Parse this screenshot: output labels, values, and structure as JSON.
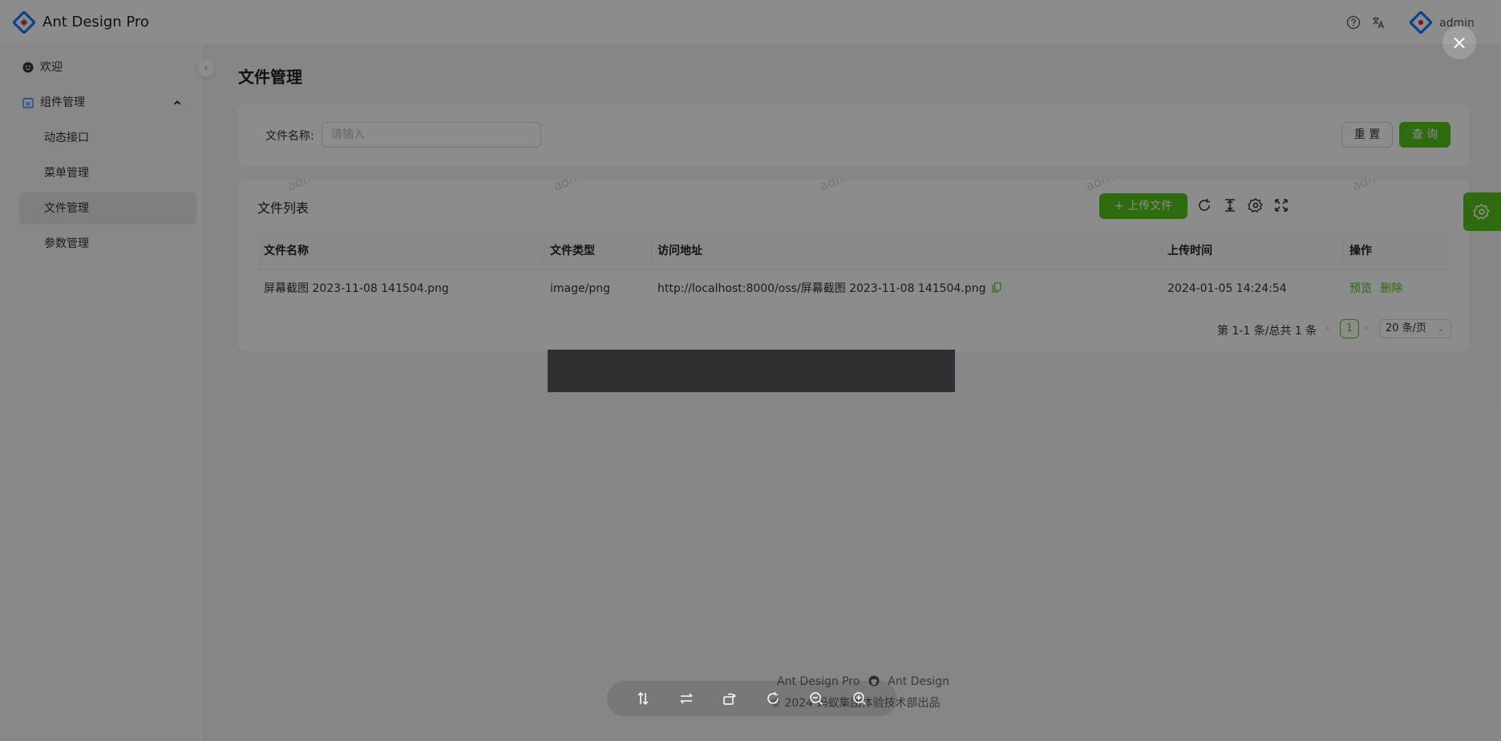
{
  "app": {
    "title": "Ant Design Pro"
  },
  "header": {
    "user_name": "admin",
    "icons": [
      "question-icon",
      "translate-icon"
    ]
  },
  "sidebar": {
    "items": [
      {
        "label": "欢迎",
        "icon": "smile-icon"
      },
      {
        "label": "组件管理",
        "icon": "component-icon",
        "expanded": true
      }
    ],
    "subitems": [
      {
        "label": "动态接口"
      },
      {
        "label": "菜单管理"
      },
      {
        "label": "文件管理",
        "active": true
      },
      {
        "label": "参数管理"
      }
    ]
  },
  "page": {
    "title": "文件管理"
  },
  "search": {
    "label": "文件名称:",
    "placeholder": "请输入",
    "reset_label": "重 置",
    "query_label": "查 询"
  },
  "table": {
    "title": "文件列表",
    "upload_label": "上传文件",
    "toolbar_icons": [
      "reload-icon",
      "density-icon",
      "setting-icon",
      "fullscreen-icon"
    ],
    "columns": [
      "文件名称",
      "文件类型",
      "访问地址",
      "上传时间",
      "操作"
    ],
    "rows": [
      {
        "name": "屏幕截图 2023-11-08 141504.png",
        "type": "image/png",
        "url": "http://localhost:8000/oss/屏幕截图 2023-11-08 141504.png",
        "time": "2024-01-05 14:24:54",
        "actions": [
          "预览",
          "删除"
        ]
      }
    ],
    "pagination": {
      "total_text": "第 1-1 条/总共 1 条",
      "current_page": "1",
      "page_size": "20 条/页"
    },
    "watermark": "admin"
  },
  "footer": {
    "links": [
      "Ant Design Pro",
      "Ant Design"
    ],
    "copyright": "2024 蚂蚁集团体验技术部出品"
  },
  "preview": {
    "toolbar_icons": [
      "flip-vertical-icon",
      "flip-horizontal-icon",
      "rotate-left-icon",
      "rotate-right-icon",
      "zoom-out-icon",
      "zoom-in-icon"
    ]
  },
  "colors": {
    "primary": "#52c41a",
    "logo_blue": "#1677ff",
    "logo_red": "#f5222d"
  }
}
